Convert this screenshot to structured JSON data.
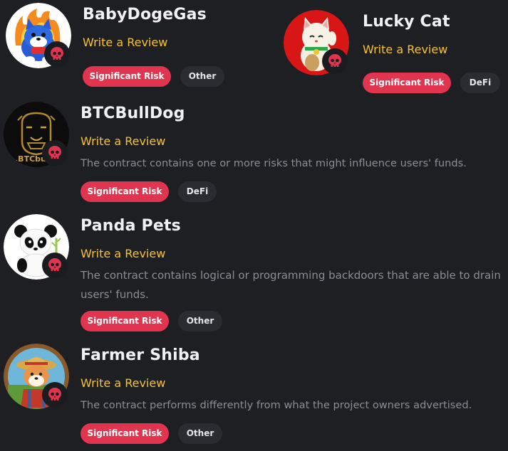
{
  "projects": [
    {
      "name": "BabyDogeGas",
      "review_label": "Write a Review",
      "description": "",
      "risk_label": "Significant Risk",
      "category": "Other"
    },
    {
      "name": "Lucky Cat",
      "review_label": "Write a Review",
      "description": "",
      "risk_label": "Significant Risk",
      "category": "DeFi"
    },
    {
      "name": "BTCBullDog",
      "review_label": "Write a Review",
      "description": "The contract contains one or more risks that might influence users' funds.",
      "risk_label": "Significant Risk",
      "category": "DeFi",
      "avatar_text": ".BTCbull"
    },
    {
      "name": "Panda Pets",
      "review_label": "Write a Review",
      "description": "The contract contains logical or programming backdoors that are able to drain  users' funds.",
      "risk_label": "Significant Risk",
      "category": "Other"
    },
    {
      "name": "Farmer Shiba",
      "review_label": "Write a Review",
      "description": "The contract performs differently from what the project owners advertised.",
      "risk_label": "Significant Risk",
      "category": "Other"
    }
  ],
  "colors": {
    "background": "#1e1f23",
    "accent_review": "#f7c22c",
    "risk_badge": "#e0344f",
    "category_badge": "#2b2c31",
    "description_text": "#8a8d96"
  },
  "icons": {
    "risk": "skull-icon"
  }
}
